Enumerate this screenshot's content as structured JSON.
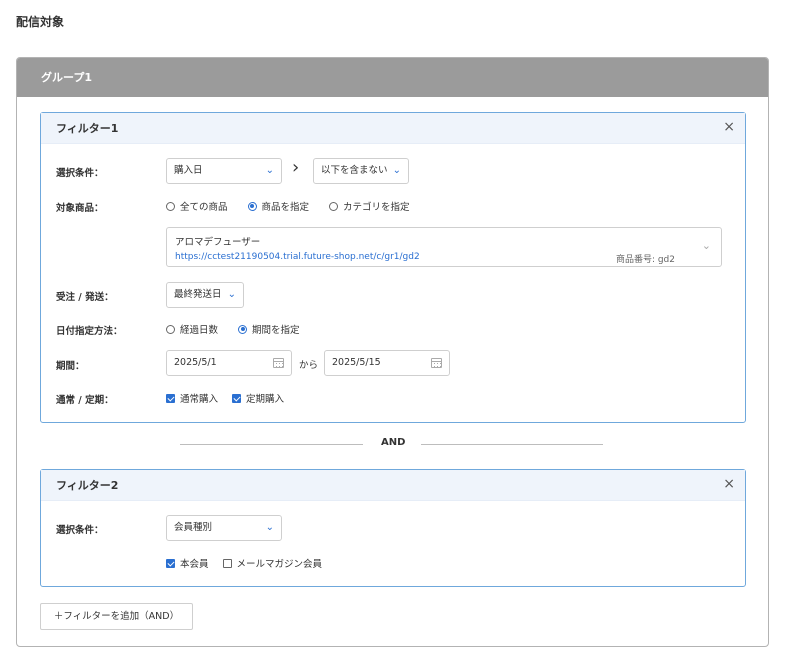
{
  "page": {
    "title": "配信対象"
  },
  "group": {
    "title": "グループ1"
  },
  "filter1": {
    "title": "フィルター1",
    "close": "×",
    "condition_label": "選択条件：",
    "condition_select": "購入日",
    "arrow": "›",
    "condition_operator": "以下を含まない",
    "product_label": "対象商品：",
    "product_options": [
      "全ての商品",
      "商品を指定",
      "カテゴリを指定"
    ],
    "product_selected": "商品を指定",
    "product": {
      "name": "アロマデフューザー",
      "url": "https://cctest21190504.trial.future-shop.net/c/gr1/gd2",
      "code": "商品番号: gd2"
    },
    "order_label": "受注 / 発送：",
    "order_select": "最終発送日",
    "date_method_label": "日付指定方法：",
    "date_method_options": [
      "経過日数",
      "期間を指定"
    ],
    "date_method_selected": "期間を指定",
    "period_label": "期間：",
    "period_from": "2025/5/1",
    "period_sep": "から",
    "period_to": "2025/5/15",
    "regular_label": "通常 / 定期：",
    "regular_options": [
      {
        "label": "通常購入",
        "checked": true
      },
      {
        "label": "定期購入",
        "checked": true
      }
    ]
  },
  "and_label": "AND",
  "filter2": {
    "title": "フィルター2",
    "close": "×",
    "condition_label": "選択条件：",
    "condition_select": "会員種別",
    "member_options": [
      {
        "label": "本会員",
        "checked": true
      },
      {
        "label": "メールマガジン会員",
        "checked": false
      }
    ]
  },
  "add_filter_button": "＋フィルターを追加（AND）",
  "colors": {
    "accent": "#2a6fd1",
    "group_header": "#9b9b9b",
    "filter_border": "#6fa8dc"
  }
}
